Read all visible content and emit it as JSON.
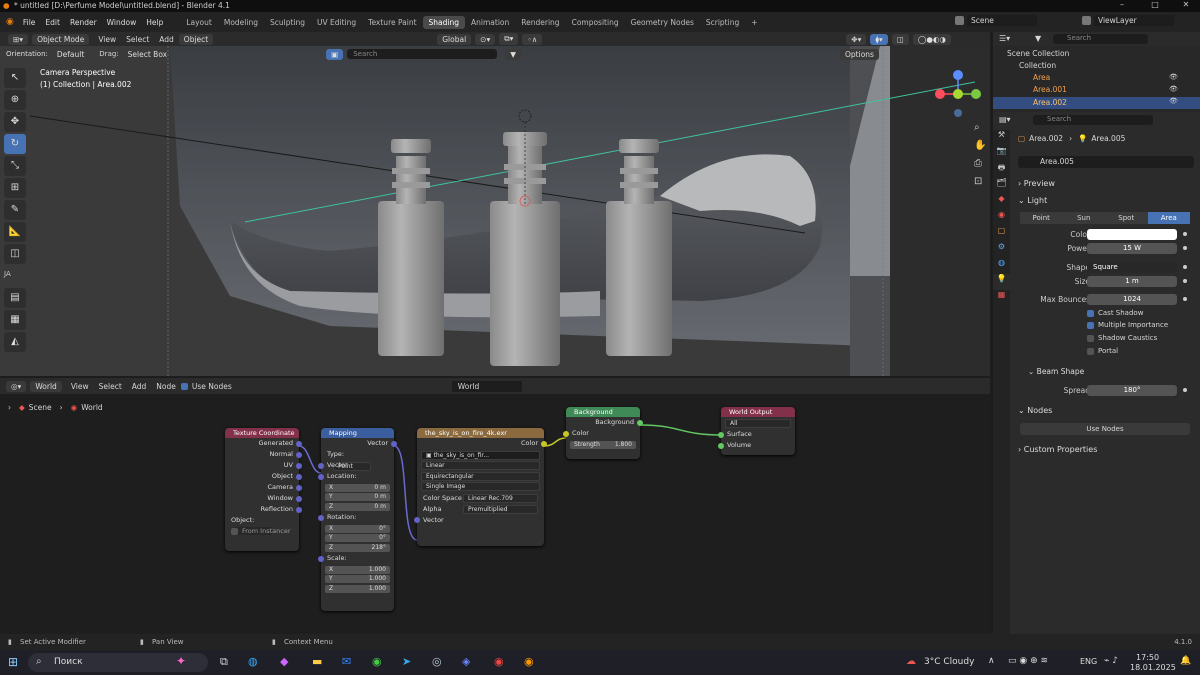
{
  "title": "* untitled [D:\\Perfume Model\\untitled.blend] - Blender 4.1",
  "menu": [
    "File",
    "Edit",
    "Render",
    "Window",
    "Help"
  ],
  "workspaces": [
    "Layout",
    "Modeling",
    "Sculpting",
    "UV Editing",
    "Texture Paint",
    "Shading",
    "Animation",
    "Rendering",
    "Compositing",
    "Geometry Nodes",
    "Scripting"
  ],
  "active_workspace": "Shading",
  "scene": "Scene",
  "view_layer": "ViewLayer",
  "viewport": {
    "mode": "Object Mode",
    "menus": [
      "View",
      "Select",
      "Add",
      "Object"
    ],
    "orientation_label": "Orientation:",
    "orientation": "Default",
    "drag_label": "Drag:",
    "drag": "Select Box",
    "transform": "Global",
    "search_placeholder": "Search",
    "options": "Options",
    "camera_text": "Camera Perspective",
    "collection_text": "(1) Collection | Area.002",
    "side_label": "JA"
  },
  "outliner": {
    "search_placeholder": "Search",
    "items": [
      "Scene Collection",
      "Collection",
      "Area",
      "Area.001",
      "Area.002"
    ]
  },
  "properties": {
    "search_placeholder": "Search",
    "breadcrumb": [
      "Area.002",
      "Area.005"
    ],
    "datablock": "Area.005",
    "sections": {
      "preview": "Preview",
      "light": "Light",
      "beam": "Beam Shape",
      "nodes": "Nodes",
      "custom": "Custom Properties"
    },
    "light_types": [
      "Point",
      "Sun",
      "Spot",
      "Area"
    ],
    "active_light_type": "Area",
    "color_label": "Color",
    "color_value": "#ffffff",
    "power_label": "Power",
    "power": "15 W",
    "shape_label": "Shape",
    "shape": "Square",
    "size_label": "Size",
    "size": "1 m",
    "bounces_label": "Max Bounces",
    "bounces": "1024",
    "checks": [
      {
        "label": "Cast Shadow",
        "on": true
      },
      {
        "label": "Multiple Importance",
        "on": true
      },
      {
        "label": "Shadow Caustics",
        "on": false
      },
      {
        "label": "Portal",
        "on": false
      }
    ],
    "spread_label": "Spread",
    "spread": "180°",
    "use_nodes": "Use Nodes"
  },
  "node_editor": {
    "type": "World",
    "menus": [
      "View",
      "Select",
      "Add",
      "Node"
    ],
    "use_nodes": "Use Nodes",
    "world": "World",
    "breadcrumb": [
      "Scene",
      "World"
    ],
    "texcoord": {
      "title": "Texture Coordinate",
      "outputs": [
        "Generated",
        "Normal",
        "UV",
        "Object",
        "Camera",
        "Window",
        "Reflection"
      ],
      "object_label": "Object:",
      "from_instancer": "From Instancer"
    },
    "mapping": {
      "title": "Mapping",
      "vector_out": "Vector",
      "type_label": "Type:",
      "type": "Point",
      "vector_in": "Vector",
      "location": "Location:",
      "loc": [
        "0 m",
        "0 m",
        "0 m"
      ],
      "rotation": "Rotation:",
      "rot": [
        "0°",
        "0°",
        "218°"
      ],
      "scale": "Scale:",
      "scl": [
        "1.000",
        "1.000",
        "1.000"
      ],
      "axes": [
        "X",
        "Y",
        "Z"
      ]
    },
    "envtex": {
      "title": "the_sky_is_on_fire_4k.exr",
      "color_out": "Color",
      "image": "the_sky_is_on_fir...",
      "interp": "Linear",
      "proj": "Equirectangular",
      "src": "Single Image",
      "cs_label": "Color Space",
      "cs": "Linear Rec.709",
      "alpha_label": "Alpha",
      "alpha": "Premultiplied",
      "vector_in": "Vector"
    },
    "background": {
      "title": "Background",
      "out": "Background",
      "color": "Color",
      "strength_label": "Strength",
      "strength": "1.800"
    },
    "output": {
      "title": "World Output",
      "target": "All",
      "surface": "Surface",
      "volume": "Volume"
    }
  },
  "statusbar": {
    "left": "Set Active Modifier",
    "mid": "Pan View",
    "right": "Context Menu",
    "version": "4.1.0"
  },
  "taskbar": {
    "search": "Поиск",
    "weather": "3°C  Cloudy",
    "lang": "ENG",
    "time": "17:50",
    "date": "18.01.2025"
  }
}
